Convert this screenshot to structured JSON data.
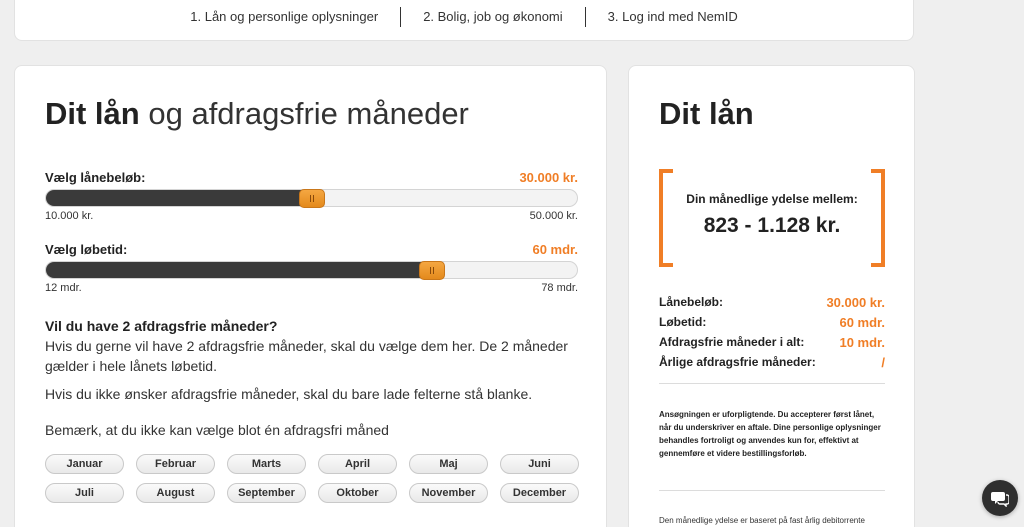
{
  "steps": [
    "1. Lån og personlige oplysninger",
    "2. Bolig, job og økonomi",
    "3. Log ind med NemID"
  ],
  "left": {
    "title_bold": "Dit lån",
    "title_rest": "og afdragsfrie måneder",
    "amount_slider": {
      "label": "Vælg lånebeløb:",
      "value": "30.000 kr.",
      "min_label": "10.000 kr.",
      "max_label": "50.000 kr.",
      "fill_fraction": 0.5
    },
    "term_slider": {
      "label": "Vælg løbetid:",
      "value": "60 mdr.",
      "min_label": "12 mdr.",
      "max_label": "78 mdr.",
      "fill_fraction": 0.727
    },
    "question_heading": "Vil du have 2 afdragsfrie måneder?",
    "question_text": "Hvis du gerne vil have 2 afdragsfrie måneder, skal du vælge dem her. De 2 måneder gælder i hele lånets løbetid.",
    "para_blank": "Hvis du ikke ønsker afdragsfrie måneder, skal du bare lade felterne stå blanke.",
    "para_note": "Bemærk, at du ikke kan vælge blot én afdragsfri måned",
    "months": [
      "Januar",
      "Februar",
      "Marts",
      "April",
      "Maj",
      "Juni",
      "Juli",
      "August",
      "September",
      "Oktober",
      "November",
      "December"
    ]
  },
  "right": {
    "title_bold": "Dit",
    "title_rest": "lån",
    "ydelse_label": "Din månedlige ydelse mellem:",
    "ydelse_value": "823 - 1.128 kr.",
    "summary": [
      {
        "key": "Lånebeløb:",
        "value": "30.000 kr."
      },
      {
        "key": "Løbetid:",
        "value": "60 mdr."
      },
      {
        "key": "Afdragsfrie måneder i alt:",
        "value": "10 mdr."
      },
      {
        "key": "Årlige afdragsfrie måneder:",
        "value": "/"
      }
    ],
    "note": "Ansøgningen er uforpligtende. Du accepterer først lånet, når du underskriver en aftale. Dine personlige oplysninger behandles fortroligt og anvendes kun for, effektivt at gennemføre et videre bestillingsforløb.",
    "note2": "Den månedlige ydelse er baseret på fast årlig debitorrente"
  },
  "colors": {
    "accent": "#f07e26",
    "dark": "#3a3a3a"
  },
  "icons": {
    "chat": "chat-bubble-icon"
  }
}
